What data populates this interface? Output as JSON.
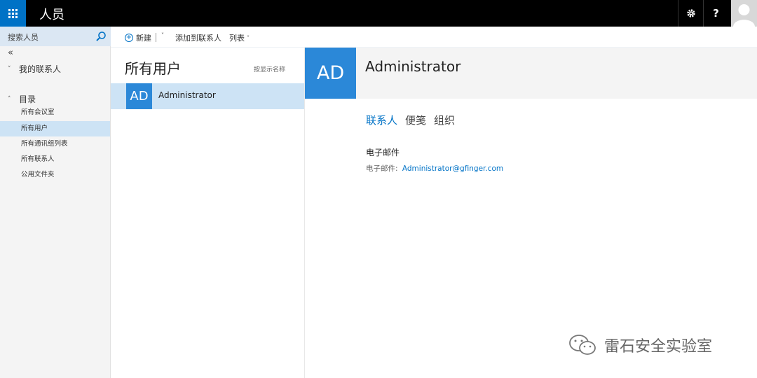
{
  "app": {
    "title": "人员"
  },
  "topbar": {
    "settings_icon": "gear-icon",
    "help_label": "?",
    "avatar_icon": "person-icon"
  },
  "leftnav": {
    "search_placeholder": "搜索人员",
    "collapse_label": "«",
    "my_contacts": {
      "chevron": "˅",
      "label": "我的联系人"
    },
    "directory": {
      "chevron": "˄",
      "label": "目录"
    },
    "items": [
      {
        "label": "所有会议室",
        "selected": false
      },
      {
        "label": "所有用户",
        "selected": true
      },
      {
        "label": "所有通讯组列表",
        "selected": false
      },
      {
        "label": "所有联系人",
        "selected": false
      },
      {
        "label": "公用文件夹",
        "selected": false
      }
    ]
  },
  "commandbar": {
    "new_icon": "+",
    "new_label": "新建",
    "new_caret": "˅",
    "add_to_contacts_label": "添加到联系人",
    "list_label": "列表",
    "list_caret": "˅"
  },
  "listpane": {
    "title": "所有用户",
    "sort_label": "按显示名称",
    "rows": [
      {
        "initials": "AD",
        "name": "Administrator"
      }
    ]
  },
  "detail": {
    "initials": "AD",
    "name": "Administrator",
    "tabs": [
      {
        "label": "联系人",
        "active": true
      },
      {
        "label": "便笺",
        "active": false
      },
      {
        "label": "组织",
        "active": false
      }
    ],
    "email_section_title": "电子邮件",
    "email_label": "电子邮件:",
    "email_value": "Administrator@gfinger.com"
  },
  "watermark": {
    "text": "雷石安全实验室"
  },
  "colors": {
    "accent": "#0072c6",
    "avatar": "#2b88d8",
    "selection": "#cde3f5",
    "topbar": "#000000"
  }
}
